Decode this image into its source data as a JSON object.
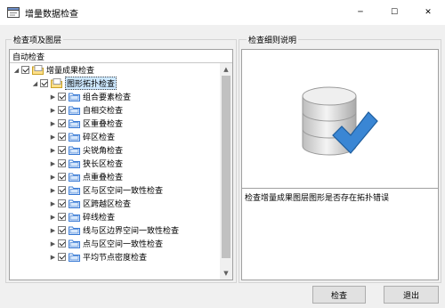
{
  "window": {
    "title": "增量数据检查",
    "controls": {
      "minimize": "─",
      "maximize": "☐",
      "close": "✕"
    }
  },
  "left_panel": {
    "group_title": "检查项及图层",
    "tree_header": "自动检查",
    "root": {
      "label": "增量成果检查",
      "expanded": true,
      "checked": true,
      "icon": "folder-icon"
    },
    "group_node": {
      "label": "图形拓扑检查",
      "expanded": true,
      "checked": true,
      "selected": true,
      "icon": "folder-icon"
    },
    "items": [
      {
        "label": "组合要素检查",
        "checked": true,
        "icon": "check-item-icon"
      },
      {
        "label": "自相交检查",
        "checked": true,
        "icon": "check-item-icon"
      },
      {
        "label": "区重叠检查",
        "checked": true,
        "icon": "check-item-icon"
      },
      {
        "label": "碎区检查",
        "checked": true,
        "icon": "check-item-icon"
      },
      {
        "label": "尖锐角检查",
        "checked": true,
        "icon": "check-item-icon"
      },
      {
        "label": "狭长区检查",
        "checked": true,
        "icon": "check-item-icon"
      },
      {
        "label": "点重叠检查",
        "checked": true,
        "icon": "check-item-icon"
      },
      {
        "label": "区与区空间一致性检查",
        "checked": true,
        "icon": "check-item-icon"
      },
      {
        "label": "区跨越区检查",
        "checked": true,
        "icon": "check-item-icon"
      },
      {
        "label": "碎线检查",
        "checked": true,
        "icon": "check-item-icon"
      },
      {
        "label": "线与区边界空间一致性检查",
        "checked": true,
        "icon": "check-item-icon"
      },
      {
        "label": "点与区空间一致性检查",
        "checked": true,
        "icon": "check-item-icon"
      },
      {
        "label": "平均节点密度检查",
        "checked": true,
        "icon": "check-item-icon"
      }
    ]
  },
  "right_panel": {
    "group_title": "检查细则说明",
    "illustration_icon": "database-check-icon",
    "description": "检查增量成果图层图形是否存在拓扑错误"
  },
  "buttons": {
    "check": "检查",
    "exit": "退出"
  }
}
